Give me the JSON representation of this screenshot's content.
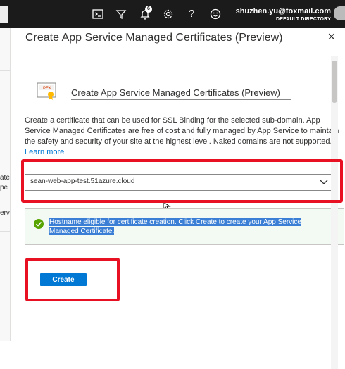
{
  "topbar": {
    "email": "shuzhen.yu@foxmail.com",
    "directory": "DEFAULT DIRECTORY",
    "notification_count": "6",
    "icons": [
      "cloud-shell-icon",
      "directory-filter-icon",
      "notifications-icon",
      "settings-icon",
      "help-icon",
      "feedback-icon"
    ]
  },
  "left_partial": {
    "line1": "ate",
    "line2": "pe",
    "line3": "erv"
  },
  "blade": {
    "title": "Create App Service Managed Certificates (Preview)",
    "close_glyph": "×"
  },
  "header": {
    "icon_text": "PFX",
    "title": "Create App Service Managed Certificates (Preview)"
  },
  "description": {
    "text": "Create a certificate that can be used for SSL Binding for the selected sub-domain. App Service Managed Certificates are free of cost and fully managed by App Service to maintain the safety and security of your site at the highest level. Naked domains are not supported.",
    "link": "Learn more"
  },
  "hostname_select": {
    "value": "sean-web-app-test.51azure.cloud"
  },
  "validation": {
    "message": "Hostname eligible for certificate creation. Click Create to create your App Service Managed Certificate."
  },
  "actions": {
    "create_label": "Create"
  },
  "colors": {
    "accent": "#0078d4",
    "highlight": "#e81123",
    "success": "#57a300",
    "topbar": "#1b1b1b"
  }
}
